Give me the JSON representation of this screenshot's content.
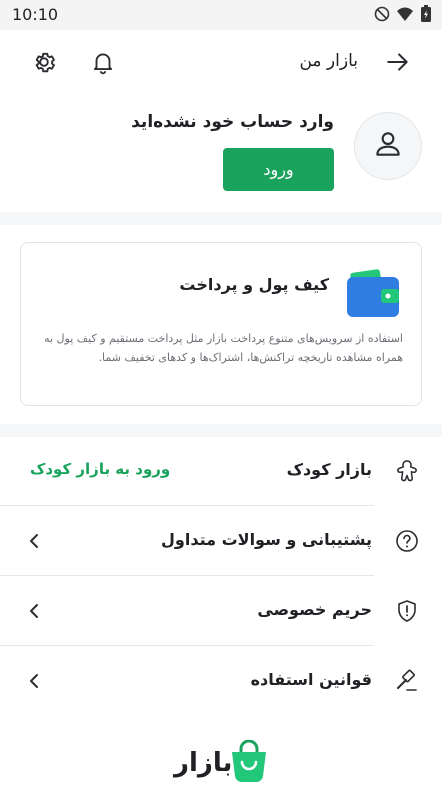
{
  "status_bar": {
    "time": "10:10"
  },
  "header": {
    "title": "بازار من"
  },
  "account": {
    "message": "وارد حساب خود نشده‌اید",
    "login_label": "ورود"
  },
  "wallet": {
    "title": "کیف پول و پرداخت",
    "description": "استفاده از سرویس‌های متنوع پرداخت بازار مثل پرداخت مستقیم و کیف پول به همراه مشاهده تاریخچه تراکنش‌ها، اشتراک‌ها و کدهای تخفیف شما."
  },
  "menu": [
    {
      "label": "بازار کودک",
      "link": "ورود به بازار کودک",
      "icon": "gingerbread-icon"
    },
    {
      "label": "پشتیبانی و سوالات متداول",
      "icon": "help-circle-icon"
    },
    {
      "label": "حریم خصوصی",
      "icon": "shield-alert-icon"
    },
    {
      "label": "قوانین استفاده",
      "icon": "gavel-icon"
    }
  ],
  "brand": {
    "name": "بازار"
  },
  "colors": {
    "accent": "#19a35d",
    "wallet_blue": "#2f7de1",
    "wallet_green": "#22c77a"
  }
}
